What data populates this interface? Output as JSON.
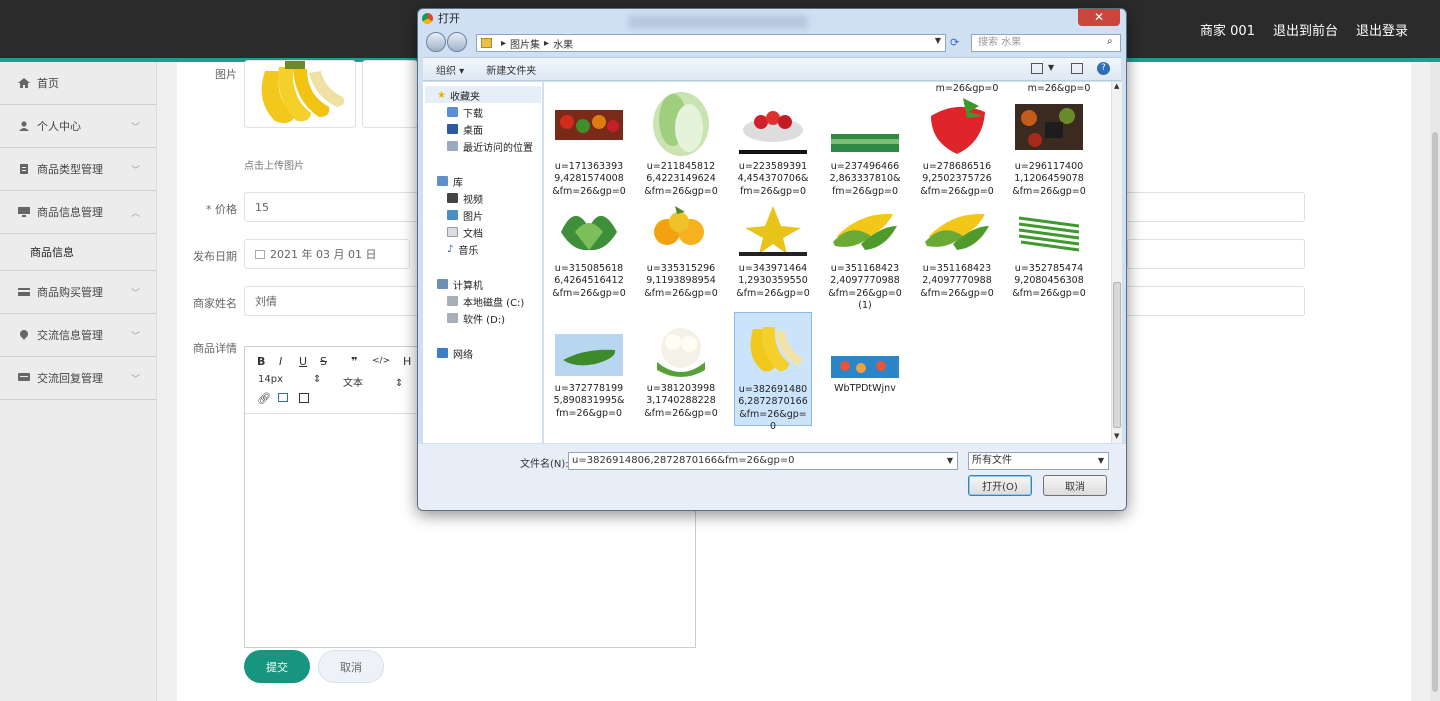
{
  "topbar": {
    "merchant": "商家 001",
    "to_front": "退出到前台",
    "logout": "退出登录"
  },
  "sidebar": {
    "items": [
      {
        "label": "首页"
      },
      {
        "label": "个人中心"
      },
      {
        "label": "商品类型管理"
      },
      {
        "label": "商品信息管理"
      },
      {
        "sub_label": "商品信息"
      },
      {
        "label": "商品购买管理"
      },
      {
        "label": "交流信息管理"
      },
      {
        "label": "交流回复管理"
      }
    ]
  },
  "form": {
    "image_label": "图片",
    "upload_hint": "点击上传图片",
    "price_label": "* 价格",
    "price_value": "15",
    "date_label": "发布日期",
    "date_value": "2021 年 03 月 01 日",
    "merchant_name_label": "商家姓名",
    "merchant_name_value": "刘倩",
    "detail_label": "商品详情",
    "editor_font_size": "14px",
    "editor_block": "文本",
    "submit": "提交",
    "cancel": "取消"
  },
  "dialog": {
    "title": "打开",
    "close": "✕",
    "path": [
      "图片集",
      "水果"
    ],
    "search_placeholder": "搜索 水果",
    "organize": "组织 ▾",
    "new_folder": "新建文件夹",
    "nav": {
      "favorites": "收藏夹",
      "downloads": "下载",
      "desktop": "桌面",
      "recent": "最近访问的位置",
      "libraries": "库",
      "videos": "视频",
      "pictures": "图片",
      "documents": "文档",
      "music": "音乐",
      "computer": "计算机",
      "local_disk": "本地磁盘 (C:)",
      "software_disk": "软件 (D:)",
      "network": "网络"
    },
    "top_partial": [
      "m=26&gp=0",
      "m=26&gp=0"
    ],
    "files": [
      {
        "name": "u=1713633939,4281574008&fm=26&gp=0",
        "kind": "veg-mix"
      },
      {
        "name": "u=2118458126,4223149624&fm=26&gp=0",
        "kind": "cabbage"
      },
      {
        "name": "u=2235893914,454370706&fm=26&gp=0",
        "kind": "strawberry-bowl"
      },
      {
        "name": "u=2374964662,863337810&fm=26&gp=0",
        "kind": "green-banner"
      },
      {
        "name": "u=2786865169,2502375726&fm=26&gp=0",
        "kind": "strawberry"
      },
      {
        "name": "u=2961174001,1206459078&fm=26&gp=0",
        "kind": "spices"
      },
      {
        "name": "u=3150856186,4264516412&fm=26&gp=0",
        "kind": "lettuce"
      },
      {
        "name": "u=3353152969,1193898954&fm=26&gp=0",
        "kind": "oranges"
      },
      {
        "name": "u=3439714641,2930359550&fm=26&gp=0",
        "kind": "starfruit"
      },
      {
        "name": "u=3511684232,4097770988&fm=26&gp=0 (1)",
        "kind": "corn"
      },
      {
        "name": "u=3511684232,4097770988&fm=26&gp=0",
        "kind": "corn"
      },
      {
        "name": "u=3527854749,2080456308&fm=26&gp=0",
        "kind": "beans"
      },
      {
        "name": "u=3727781995,890831995&fm=26&gp=0",
        "kind": "cucumber"
      },
      {
        "name": "u=3812039983,1740288228&fm=26&gp=0",
        "kind": "cauliflower"
      },
      {
        "name": "u=3826914806,2872870166&fm=26&gp=0",
        "kind": "banana"
      },
      {
        "name": "WbTPDtWjnv",
        "kind": "seafood"
      }
    ],
    "filename_label": "文件名(N):",
    "filename_value": "u=3826914806,2872870166&fm=26&gp=0",
    "filetype": "所有文件",
    "open": "打开(O)",
    "cancel": "取消"
  }
}
